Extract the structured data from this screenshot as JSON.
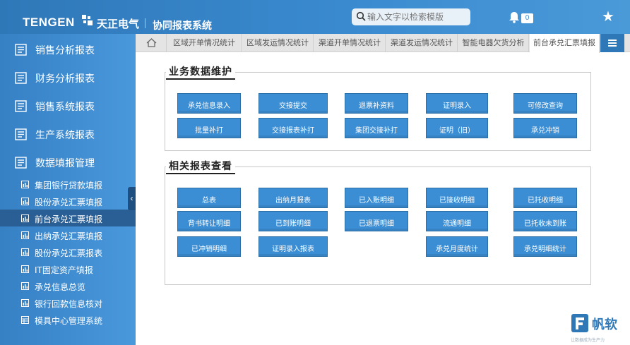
{
  "header": {
    "logo_text": "TENGEN",
    "logo_cn": "天正电气",
    "system_title": "协同报表系统",
    "search_placeholder": "输入文字以检索模版",
    "notification_count": "0",
    "star_glyph": "★"
  },
  "sidebar": {
    "main_items": [
      {
        "label": "销售分析报表"
      },
      {
        "label": "财务分析报表"
      },
      {
        "label": "销售系统报表"
      },
      {
        "label": "生产系统报表"
      },
      {
        "label": "数据填报管理"
      }
    ],
    "sub_items": [
      {
        "label": "集团银行贷款填报"
      },
      {
        "label": "股份承兑汇票填报"
      },
      {
        "label": "前台承兑汇票填报",
        "active": true
      },
      {
        "label": "出纳承兑汇票填报"
      },
      {
        "label": "股份承兑汇票报表"
      },
      {
        "label": "IT固定资产填报"
      },
      {
        "label": "承兑信息总览"
      },
      {
        "label": "银行回款信息核对"
      },
      {
        "label": "模具中心管理系统"
      }
    ],
    "collapse_glyph": "‹"
  },
  "tabs": [
    {
      "label": "区域开单情况统计"
    },
    {
      "label": "区域发运情况统计"
    },
    {
      "label": "渠道开单情况统计"
    },
    {
      "label": "渠道发运情况统计"
    },
    {
      "label": "智能电器欠货分析"
    },
    {
      "label": "前台承兑汇票填报",
      "active": true
    }
  ],
  "panel1": {
    "title": "业务数据维护",
    "buttons": [
      "承兑信息录入",
      "交接提交",
      "退票补资料",
      "证明录入",
      "可修改查询",
      "批量补打",
      "交接报表补打",
      "集团交接补打",
      "证明（旧）",
      "承兑冲销"
    ]
  },
  "panel2": {
    "title": "相关报表查看",
    "buttons": [
      "总表",
      "出纳月报表",
      "已入账明细",
      "已接收明细",
      "已托收明细",
      "背书转让明细",
      "已到账明细",
      "已退票明细",
      "流通明细",
      "已托收未到账",
      "已冲销明细",
      "证明录入报表",
      "承兑月度统计",
      "承兑明细统计"
    ]
  },
  "brand": {
    "name": "帆软",
    "slogan": "让数据成为生产力"
  },
  "colors": {
    "header_blue": "#3a8ad0",
    "sidebar_blue": "#4a98dc",
    "active_item": "#2a5f95",
    "button_blue": "#3b8ed4"
  }
}
